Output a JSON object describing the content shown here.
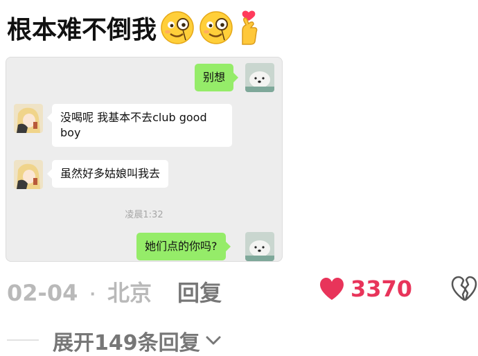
{
  "comment": {
    "text": "根本难不倒我",
    "emojis": [
      "grinning-face-with-monocle",
      "grinning-face-with-monocle",
      "heart-hands-finger"
    ]
  },
  "chat": {
    "messages": [
      {
        "side": "right",
        "text": "别想",
        "avatar": "samoyed-dog-avatar"
      },
      {
        "side": "left",
        "text": "没喝呢 我基本不去club  good boy",
        "avatar": "anime-girl-avatar"
      },
      {
        "side": "left",
        "text": "虽然好多姑娘叫我去",
        "avatar": "anime-girl-avatar"
      },
      {
        "side": "right",
        "text": "她们点的你吗?",
        "avatar": "samoyed-dog-avatar"
      }
    ],
    "timestamp": "凌晨1:32",
    "colors": {
      "bg": "#ededed",
      "right_bubble": "#95ec69",
      "left_bubble": "#ffffff"
    }
  },
  "meta": {
    "date": "02-04",
    "separator": "·",
    "location": "北京",
    "reply_label": "回复",
    "like_count": "3370",
    "like_color": "#e8345a"
  },
  "expand": {
    "label": "展开149条回复"
  }
}
